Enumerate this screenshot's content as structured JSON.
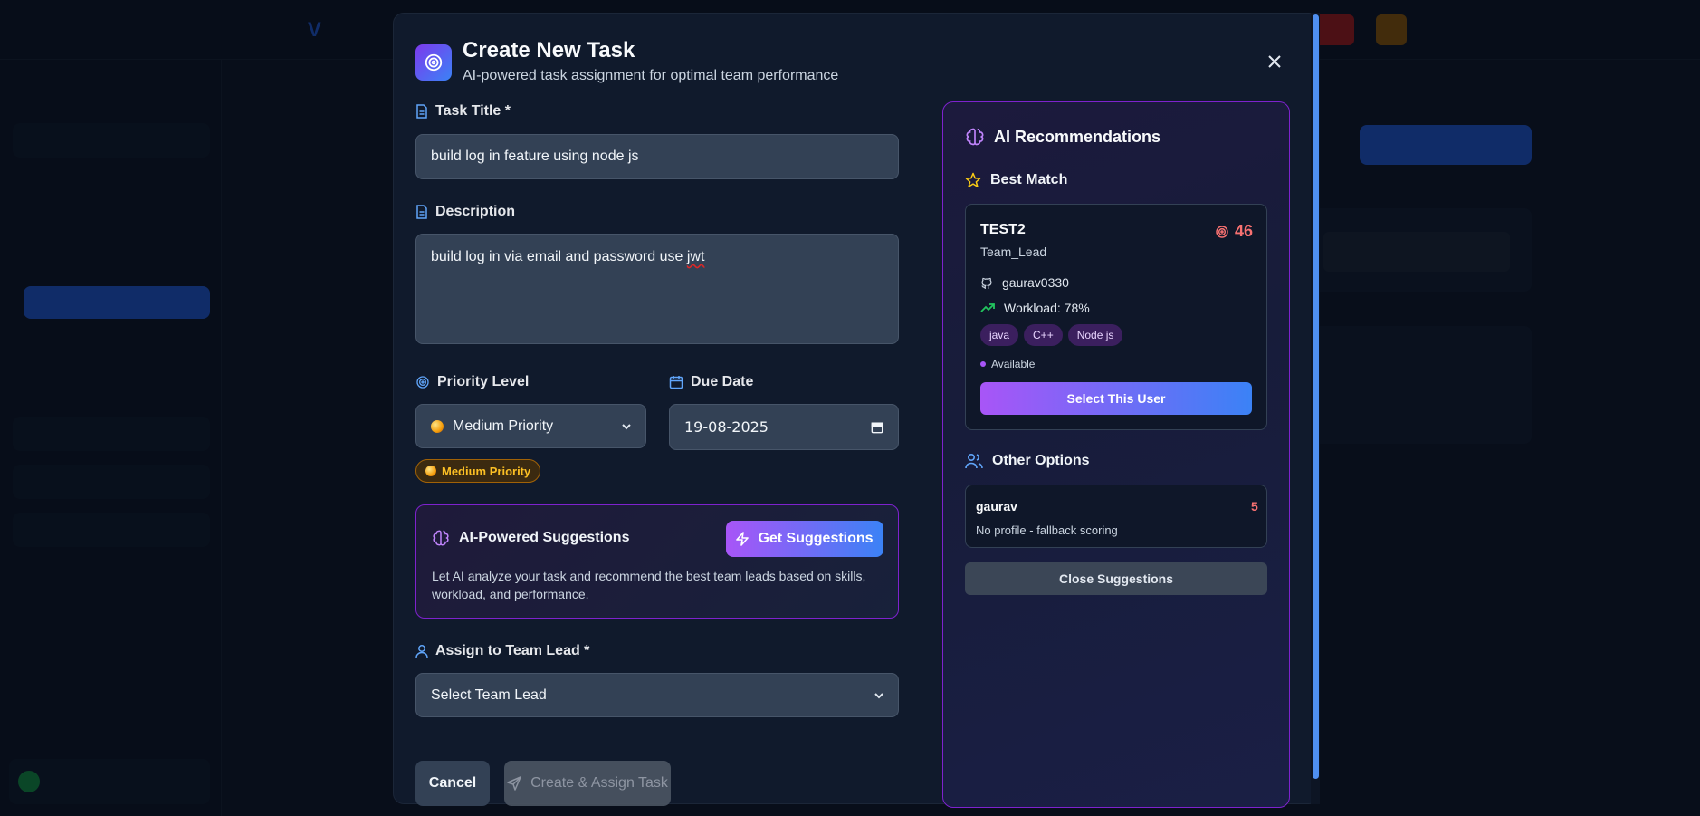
{
  "modal": {
    "title": "Create New Task",
    "subtitle": "AI-powered task assignment for optimal team performance"
  },
  "form": {
    "task_title_label": "Task Title *",
    "task_title_value": "build log in feature using node js",
    "description_label": "Description",
    "description_value_prefix": "build log in via email and password use ",
    "description_value_misspelled": "jwt",
    "priority_label": "Priority Level",
    "priority_value": "Medium Priority",
    "due_date_label": "Due Date",
    "due_date_value": "19-08-2025",
    "priority_badge": "Medium Priority",
    "assign_label": "Assign to Team Lead *",
    "assign_placeholder": "Select Team Lead",
    "cancel_label": "Cancel",
    "create_label": "Create & Assign Task"
  },
  "ai_card": {
    "title": "AI-Powered Suggestions",
    "button_label": "Get Suggestions",
    "description": "Let AI analyze your task and recommend the best team leads based on skills, workload, and performance."
  },
  "recommendations": {
    "title": "AI Recommendations",
    "best_match_label": "Best Match",
    "best": {
      "name": "TEST2",
      "role": "Team_Lead",
      "score": "46",
      "github": "gaurav0330",
      "workload": "Workload: 78%",
      "skills": [
        "java",
        "C++",
        "Node js"
      ],
      "status": "Available",
      "select_label": "Select This User"
    },
    "other_options_label": "Other Options",
    "others": [
      {
        "name": "gaurav",
        "score": "5",
        "desc": "No profile - fallback scoring"
      }
    ],
    "close_label": "Close Suggestions"
  },
  "colors": {
    "accent_purple": "#a855f7",
    "accent_blue": "#3b82f6",
    "score_red": "#f87171",
    "priority_amber": "#fbbf24"
  }
}
